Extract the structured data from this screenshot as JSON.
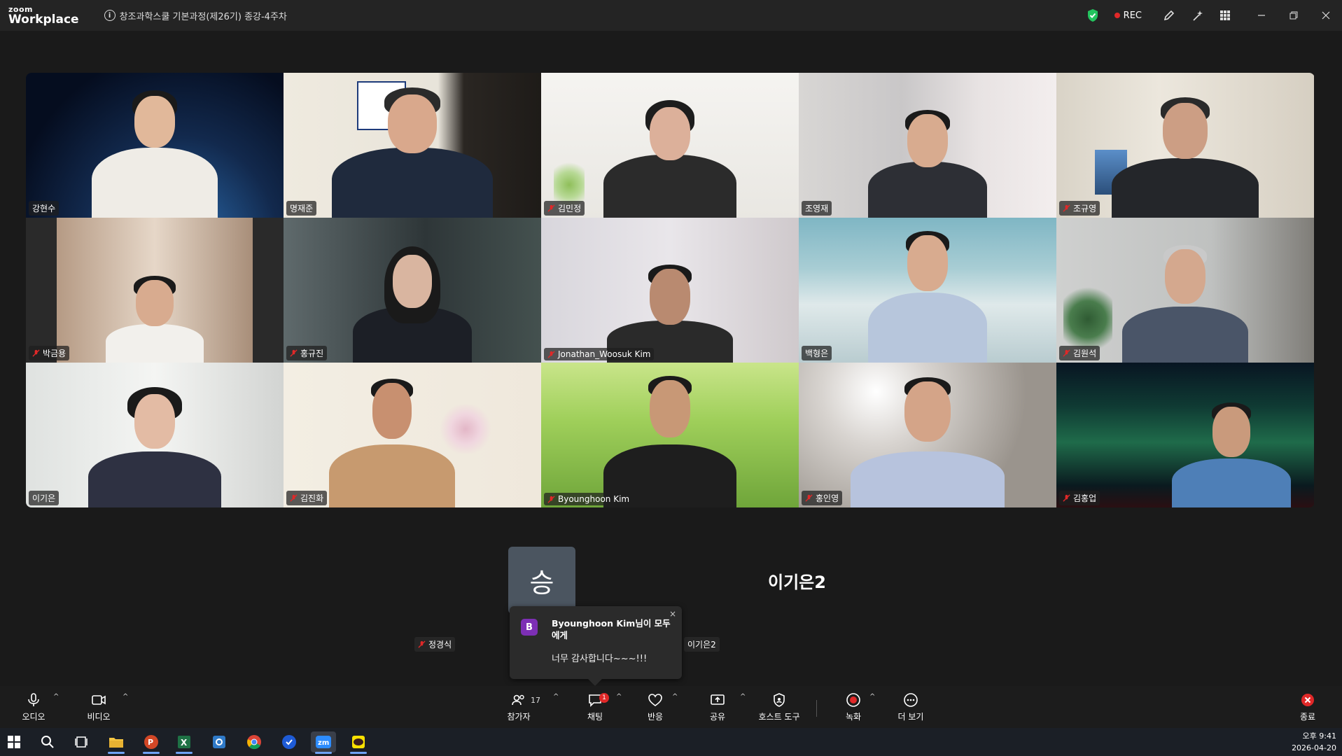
{
  "app": {
    "logo_line1": "zoom",
    "logo_line2": "Workplace"
  },
  "meeting": {
    "title": "창조과학스쿨 기본과정(제26기) 종강-4주차",
    "rec_label": "REC"
  },
  "participants": [
    {
      "name": "강현수",
      "muted": false,
      "active": false
    },
    {
      "name": "명재준",
      "muted": false,
      "active": false
    },
    {
      "name": "김민정",
      "muted": true,
      "active": false
    },
    {
      "name": "조영재",
      "muted": false,
      "active": false
    },
    {
      "name": "조규영",
      "muted": true,
      "active": false
    },
    {
      "name": "박금용",
      "muted": true,
      "active": false
    },
    {
      "name": "홍규진",
      "muted": true,
      "active": false
    },
    {
      "name": "Jonathan_Woosuk Kim",
      "muted": true,
      "active": false
    },
    {
      "name": "백형은",
      "muted": false,
      "active": true
    },
    {
      "name": "김원석",
      "muted": true,
      "active": false
    },
    {
      "name": "이기은",
      "muted": false,
      "active": false
    },
    {
      "name": "김진화",
      "muted": true,
      "active": false
    },
    {
      "name": "Byounghoon Kim",
      "muted": true,
      "active": false
    },
    {
      "name": "홍인영",
      "muted": true,
      "active": false
    },
    {
      "name": "김홍업",
      "muted": true,
      "active": false
    }
  ],
  "lower": {
    "avatar_letter": "승",
    "big_name": "이기은2",
    "tag_left": "정경식",
    "tag_right": "이기은2"
  },
  "chat_popup": {
    "avatar_letter": "B",
    "sender": "Byounghoon Kim님이 모두에게",
    "message": "너무 감사합니다~~~!!!",
    "close": "×"
  },
  "toolbar": {
    "audio": "오디오",
    "video": "비디오",
    "participants": "참가자",
    "participants_count": "17",
    "chat": "채팅",
    "chat_badge": "1",
    "reactions": "반응",
    "share": "공유",
    "host_tools": "호스트 도구",
    "record": "녹화",
    "more": "더 보기",
    "end": "종료"
  },
  "taskbar": {
    "time": "오후 9:41",
    "date": "2026-04-20"
  },
  "colors": {
    "active_border": "#23d96b",
    "rec": "#e02828",
    "chat_avatar": "#7d2fb5"
  }
}
